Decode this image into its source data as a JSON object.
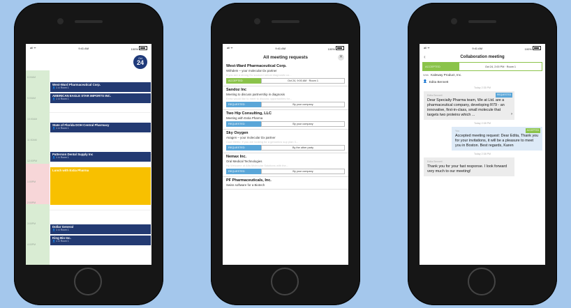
{
  "colors": {
    "background": "#a4c7ec",
    "event": "#233a72",
    "lunch": "#f8c000",
    "green": "#8bc34a",
    "blue_tag": "#5aa6d8"
  },
  "status": {
    "carrier": "all ᯤ",
    "time": "9:41 AM",
    "battery": "100%"
  },
  "calendar": {
    "month": "Oct",
    "day": "24",
    "times": [
      "8:00AM",
      "9:00AM",
      "10:00AM",
      "11:00AM",
      "12:00PM",
      "1:00PM",
      "2:00PM",
      "3:00PM",
      "4:00PM"
    ],
    "events": [
      {
        "title": "West-Ward Pharmaceutical Corp.",
        "sub": "👤 1  ⊙  Room 1"
      },
      {
        "title": "AMERICAN EAGLE STAR IMPORTS INC.",
        "sub": "👤 1  ⊙  Room 1"
      },
      {
        "title": "State of Florida DOH Central Pharmacy",
        "sub": "👤 1  ⊙  Room 1"
      },
      {
        "title": "Patterson Dental Supply Inc",
        "sub": "👤 1  ⊙  Room 1"
      },
      {
        "title": "Dollar General",
        "sub": "👤 1  ⊙  Room 1"
      },
      {
        "title": "King Bio Inc.",
        "sub": "👤 1  ⊙  Room 1"
      }
    ],
    "lunch": "Lunch with Extia Pharma"
  },
  "requests": {
    "title": "All meeting requests",
    "close": "✕",
    "items": [
      {
        "name": "West-Ward Pharmaceutical Corp.",
        "desc": "Withdem – your molecular Dx partner",
        "blur": "If you are a strong Eu sourced robust diagnostic co...",
        "tag": "ACCEPTED",
        "info": "Oct 24, 9:00 AM · Room 1",
        "tagcolor": "#8bc34a"
      },
      {
        "name": "Sandoz Inc",
        "desc": "Meeting to discuss partnership in diagnosis",
        "blur": "Extra would like to meet to discuss opportunities for...",
        "tag": "REQUESTED",
        "info": "By your company",
        "tagcolor": "#5aa6d8"
      },
      {
        "name": "Two Hip Consulting, LLC",
        "desc": "Meeting with Extia Pharma",
        "blur": "",
        "tag": "REQUESTED",
        "info": "By your company",
        "tagcolor": "#5aa6d8"
      },
      {
        "name": "Sky Oxygen",
        "desc": "Anagen – your molecular Dx partner",
        "blur": "Cool Metric: If you are looking for a genomics sup plan 3...",
        "tag": "REQUESTED",
        "info": "By the other party",
        "tagcolor": "#5aa6d8"
      },
      {
        "name": "Nemax Inc.",
        "desc": "Oral Medical Technologies",
        "blur": "Hy Welcome at Alfa Molecular Solutions with the...",
        "tag": "REQUESTED",
        "info": "By your company",
        "tagcolor": "#5aa6d8"
      },
      {
        "name": "PF Pharmaceuticals, Inc.",
        "desc": "Swiss software for a Biotech",
        "blur": "",
        "tag": "",
        "info": "",
        "tagcolor": "#5aa6d8"
      }
    ]
  },
  "chat": {
    "title": "Collaboration meeting",
    "back": "‹",
    "status": "ACCEPTED",
    "datetime": "Oct 24, 2:00 PM · Room 1",
    "with_label": "With",
    "with": "Kaleway Product, Inc.",
    "attendee": "Edita Bennett",
    "messages": [
      {
        "type": "in",
        "time": "Today 2:35 PM",
        "who": "Edita Bennett",
        "text": "Dear Specialty Pharma team, We at Ltd. are a pharmaceutical company, developing R79 - an innovative, first-in-class, small molecule that targets two proteins which ...",
        "chip": "REQUESTED",
        "more": "›"
      },
      {
        "type": "out",
        "time": "Today 2:38 PM",
        "who": "You",
        "text": "Accepted meeting request: Dear Edita, Thank you for your invitations, it will be a pleasure to meet you in Boston. Best regards, Karen",
        "chip": "ACCEPTED"
      },
      {
        "type": "in",
        "time": "Today 2:38 PM",
        "who": "Edita Bennett",
        "text": "Thank you for your fast response. I look forward very much to our meeting!"
      }
    ]
  }
}
